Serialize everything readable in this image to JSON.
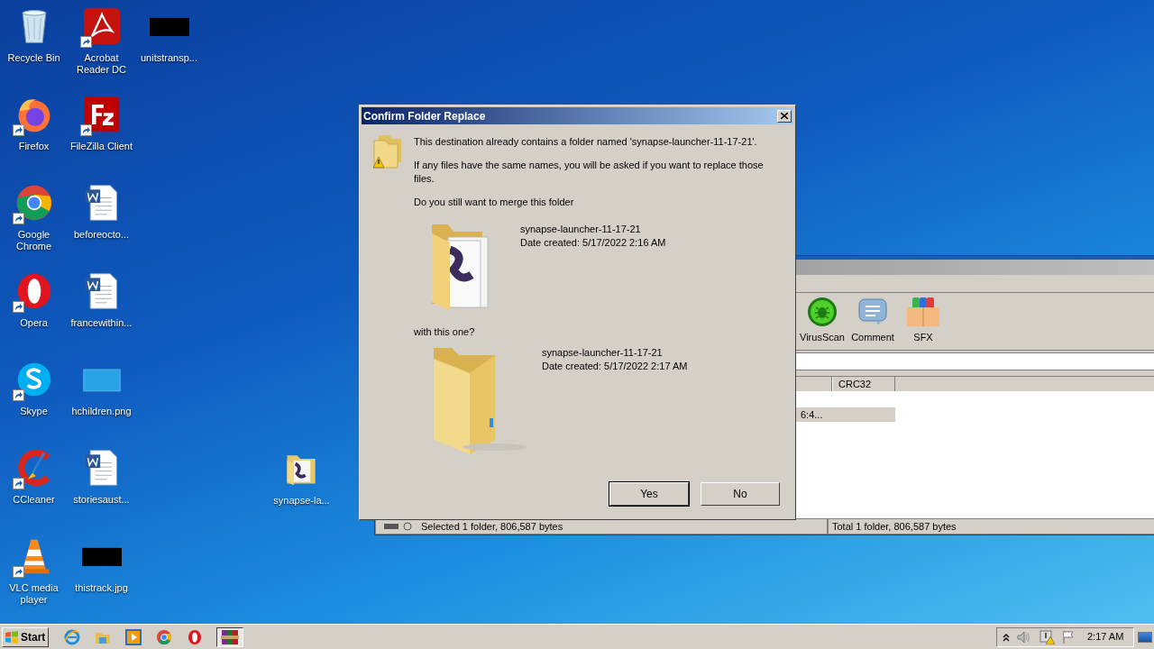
{
  "desktop_columns": [
    [
      {
        "label": "Recycle Bin",
        "kind": "recycle",
        "shortcut": false
      },
      {
        "label": "Firefox",
        "kind": "firefox",
        "shortcut": true
      },
      {
        "label": "Google Chrome",
        "kind": "chrome",
        "shortcut": true
      },
      {
        "label": "Opera",
        "kind": "opera",
        "shortcut": true
      },
      {
        "label": "Skype",
        "kind": "skype",
        "shortcut": true
      },
      {
        "label": "CCleaner",
        "kind": "ccleaner",
        "shortcut": true
      },
      {
        "label": "VLC media player",
        "kind": "vlc",
        "shortcut": true
      }
    ],
    [
      {
        "label": "Acrobat Reader DC",
        "kind": "acrobat",
        "shortcut": true
      },
      {
        "label": "FileZilla Client",
        "kind": "filezilla",
        "shortcut": true
      },
      {
        "label": "beforeocto...",
        "kind": "word",
        "shortcut": false
      },
      {
        "label": "francewithin...",
        "kind": "word",
        "shortcut": false
      },
      {
        "label": "hchildren.png",
        "kind": "blank",
        "shortcut": false
      },
      {
        "label": "storiesaust...",
        "kind": "word",
        "shortcut": false
      },
      {
        "label": "thistrack.jpg",
        "kind": "black",
        "shortcut": false
      }
    ],
    [
      {
        "label": "unitstransp...",
        "kind": "black",
        "shortcut": false
      }
    ]
  ],
  "dropped_item": {
    "label": "synapse-la...",
    "kind": "folder"
  },
  "archiver_window": {
    "toolbar": [
      {
        "label": "VirusScan",
        "kind": "virus"
      },
      {
        "label": "Comment",
        "kind": "comment"
      },
      {
        "label": "SFX",
        "kind": "sfx"
      }
    ],
    "columns": [
      "CRC32"
    ],
    "rows": [
      {
        "cells": [
          "6:4..."
        ],
        "selected": true
      }
    ],
    "status": [
      "Selected 1 folder, 806,587 bytes",
      "Total 1 folder, 806,587 bytes"
    ]
  },
  "dialog": {
    "title": "Confirm Folder Replace",
    "message": [
      "This destination already contains a folder named 'synapse-launcher-11-17-21'.",
      "If any files have the same names, you will be asked if you want to replace those files.",
      "Do you still want to merge this folder"
    ],
    "existing": {
      "name": "synapse-launcher-11-17-21",
      "date": "Date created: 5/17/2022 2:16 AM",
      "kind": "with_content"
    },
    "with_label": "with this one?",
    "incoming": {
      "name": "synapse-launcher-11-17-21",
      "date": "Date created: 5/17/2022 2:17 AM",
      "kind": "empty"
    },
    "buttons": [
      {
        "label": "Yes",
        "default": true
      },
      {
        "label": "No",
        "default": false
      }
    ]
  },
  "taskbar": {
    "start": "Start",
    "apps": [
      {
        "kind": "ie",
        "active": false
      },
      {
        "kind": "explorer",
        "active": false
      },
      {
        "kind": "media",
        "active": false
      },
      {
        "kind": "chrome",
        "active": false
      },
      {
        "kind": "opera",
        "active": false
      },
      {
        "kind": "winrar",
        "active": true
      }
    ],
    "clock": "2:17 AM"
  }
}
